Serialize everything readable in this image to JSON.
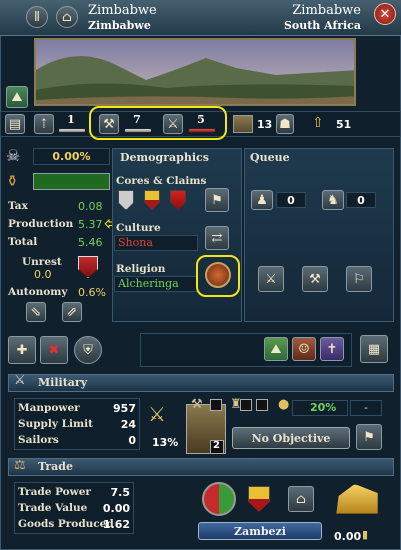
{
  "header": {
    "province_name": "Zimbabwe",
    "area_name": "Zimbabwe",
    "owner_name": "Zimbabwe",
    "region_name": "South Africa"
  },
  "dev_row": {
    "tax_level": "1",
    "production_level": "7",
    "manpower_level": "5",
    "devastation": "13",
    "development_total": "51"
  },
  "economy": {
    "percent": "0.00%",
    "tax_label": "Tax",
    "tax_value": "0.08",
    "production_label": "Production",
    "production_value": "5.37",
    "total_label": "Total",
    "total_value": "5.46",
    "unrest_label": "Unrest",
    "unrest_value": "0.0",
    "autonomy_label": "Autonomy",
    "autonomy_value": "0.6%"
  },
  "demographics": {
    "title": "Demographics",
    "cores_label": "Cores & Claims",
    "culture_label": "Culture",
    "culture_value": "Shona",
    "religion_label": "Religion",
    "religion_value": "Alcheringa"
  },
  "queue": {
    "title": "Queue",
    "infantry_count": "0",
    "cavalry_count": "0"
  },
  "military": {
    "title": "Military",
    "manpower_label": "Manpower",
    "manpower_value": "957",
    "supply_label": "Supply Limit",
    "supply_value": "24",
    "sailors_label": "Sailors",
    "sailors_value": "0",
    "martial_percent": "13%",
    "fort_level": "2",
    "fort_percent": "20%",
    "fort_dash": "-",
    "objective_label": "No Objective"
  },
  "trade": {
    "title": "Trade",
    "power_label": "Trade Power",
    "power_value": "7.5",
    "value_label": "Trade Value",
    "value_value": "0.00",
    "goods_label": "Goods Produced",
    "goods_value": "1.62",
    "node_name": "Zambezi",
    "goods_income": "0.00"
  },
  "colors": {
    "accent_green": "#6fd35b",
    "accent_red": "#d9453a",
    "highlight": "#f4e614"
  }
}
